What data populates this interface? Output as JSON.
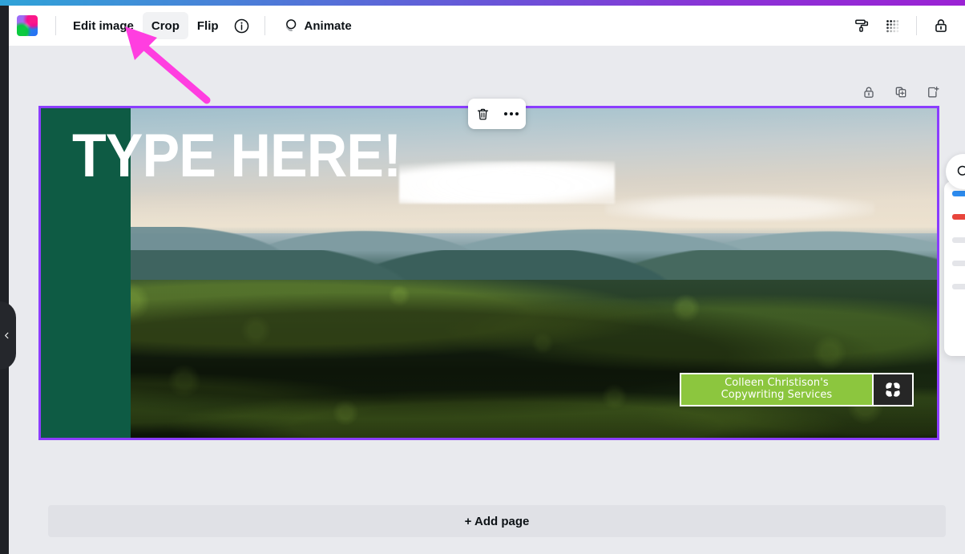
{
  "app": {
    "name": "Canva Editor"
  },
  "toolbar": {
    "thumbnail_name": "image-thumbnail",
    "edit_image_label": "Edit image",
    "crop_label": "Crop",
    "flip_label": "Flip",
    "info_icon": "info-circle-icon",
    "animate_label": "Animate",
    "animate_icon": "animate-stacked-circles-icon",
    "right_icons": [
      {
        "name": "paint-roller-icon",
        "label": "Edit colors"
      },
      {
        "name": "transparency-checker-icon",
        "label": "Transparency"
      },
      {
        "name": "lock-icon",
        "label": "Lock"
      }
    ]
  },
  "element_toolbar": {
    "delete_icon": "trash-icon",
    "more_icon": "more-options-icon"
  },
  "page_tools": [
    {
      "name": "lock-page-icon",
      "label": "Lock page"
    },
    {
      "name": "duplicate-page-icon",
      "label": "Duplicate page"
    },
    {
      "name": "add-page-icon",
      "label": "Add page"
    }
  ],
  "canvas": {
    "headline": "TYPE HERE!",
    "selection_color": "#8b3dff",
    "band_color": "#0e5b44",
    "brand": {
      "line1": "Colleen Christison's",
      "line2": "Copywriting Services",
      "chip_color": "#8cc63e",
      "logo_name": "clover-flower-logo",
      "logo_bg": "#262626"
    },
    "image_description": "aerial photo of forested hills under a hazy sky"
  },
  "add_page": {
    "label": "+ Add page"
  },
  "left_rail": {
    "collapse_icon": "chevron-left-icon"
  },
  "annotation": {
    "arrow_color": "#ff3ee0",
    "arrow_name": "pink-pointer-arrow"
  }
}
